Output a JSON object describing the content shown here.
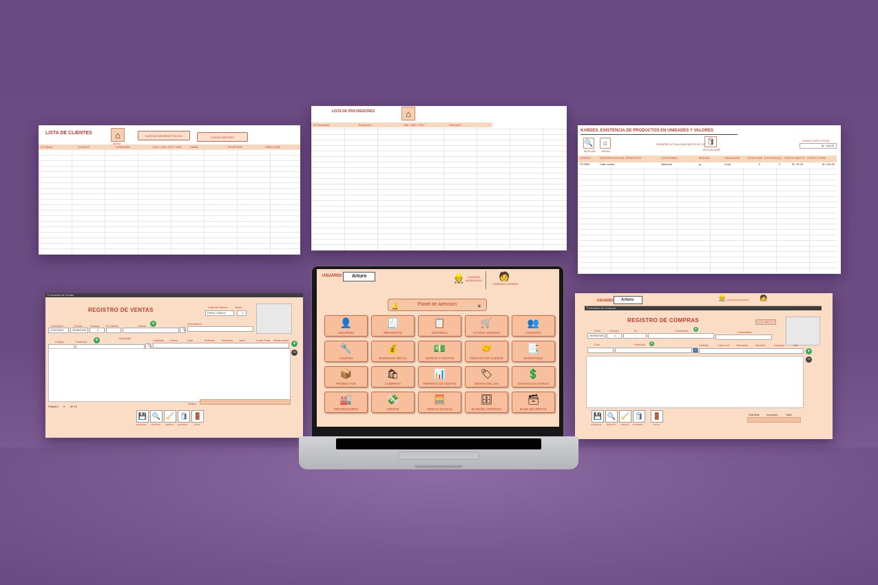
{
  "clientes": {
    "title": "LISTA DE CLIENTES",
    "home_label": "MENU",
    "btn_buscar": "BUSCAR INFORME POR DIA",
    "btn_consultas": "CONSULTAR INFO",
    "headers": [
      "ID Cliente",
      "CLIENTE",
      "COMPAÑÍA",
      "RUC / DNI / RUT / NRC",
      "EMAIL",
      "TELÉFONO",
      "DIRECCIÓN"
    ]
  },
  "proveedores": {
    "title": "LISTA DE PROVEEDORES",
    "headers": [
      "ID Proveedor",
      "Proveedor",
      "DNI / RNC / RUT",
      "Dirección"
    ]
  },
  "kardex": {
    "title": "KARDEX, EXISTENCIA DE PRODUCTOS EN UNIDADES Y VALORES",
    "btn_buscar": "BUSCAR",
    "btn_menu": "MENU",
    "note": "SIEMPRE ACTUALIZAR ANTES DE USAR",
    "btn_actualizar": "ACTUALIZAR",
    "suma_label": "SUMA COSTO TOTAL",
    "suma_value": "$/. 144.00",
    "headers": [
      "CODIGO",
      "DESCRIPCION DEL PRODUCTO",
      "CATEGORIA",
      "MEDIDA",
      "UBICACION",
      "STOCK MINIMO",
      "EXISTENCIA (UNIDADES)",
      "COSTO UNIT PROMEDIO",
      "COSTO TOTAL"
    ],
    "row": [
      "PC2504",
      "Cafe molido",
      "Nacional",
      "pr",
      "Lima",
      "5",
      "2",
      "$/. 20.00",
      "$/. 144.00"
    ]
  },
  "ventas": {
    "bar": "Formulario de Ventas",
    "title": "REGISTRO DE VENTAS",
    "lbl_lista": "Lista de Precios",
    "lbl_stock": "Stock",
    "lbl_condicion": "Condición",
    "lbl_fecha": "Fecha",
    "lbl_factura": "Factura",
    "lbl_cliente": "ID Cliente",
    "lbl_cliente2": "Cliente",
    "lbl_comentario": "Comentario",
    "val_condicion": "CONTADO",
    "val_fecha": "25/06/2025",
    "val_factura": "1",
    "val_lista": "Precio x Menor",
    "val_stock": "1",
    "lbl_codigo": "Codigo",
    "lbl_producto": "Producto",
    "lbl_contenido": "Contenido",
    "cols": [
      "Cantidad",
      "Precio",
      "Subt",
      "Subtotal",
      "Impuesto",
      "Total",
      "Costo Total",
      "Observación"
    ],
    "registro": "Registro",
    "registro_n": "9",
    "registro_de": "de 12",
    "totales": "Totales",
    "buttons": [
      "GUARDAR",
      "BUSCAR",
      "LIMPIAR",
      "ELIMINAR",
      "SALIR"
    ]
  },
  "compras": {
    "usuario_label": "USUARIO:",
    "usuario": "Arturo",
    "ajustar": "AJUSTAR INVENTARIO",
    "cambiar": "CAMBIAR USUARIO",
    "bar": "Formulario de Compras",
    "title": "REGISTRO DE COMPRAS",
    "num": "1",
    "lbl_fecha": "Fech",
    "lbl_factura": "Factura",
    "lbl_id": "ID",
    "lbl_proveedor": "Proveedor",
    "lbl_comentario": "Comentario",
    "val_fecha": "25/06/2025",
    "val_factura": "1",
    "lbl_cod": "Cod.",
    "lbl_producto": "Producto",
    "cols": [
      "Cantidad",
      "Costo Unit",
      "Descuento",
      "SubTotal",
      "Impuesto",
      "Total"
    ],
    "buttons": [
      "GUARDAR",
      "BUSCAR",
      "LIMPIAR",
      "ELIMINAR",
      "SALIR"
    ],
    "foot": [
      "SubTotal",
      "Impuesto",
      "Total"
    ]
  },
  "main": {
    "usuario_label": "USUARIO:",
    "usuario": "Arturo",
    "ajustar": "AJUSTAR INVENTARIO",
    "cambiar": "CAMBIAR USUARIO",
    "panel_title": "Panel de Atencion",
    "buttons": [
      {
        "label": "USUARIOS",
        "icon": "users-icon",
        "glyph": "👤"
      },
      {
        "label": "IMPUESTOS",
        "icon": "tax-icon",
        "glyph": "🧾"
      },
      {
        "label": "HISTORIAL",
        "icon": "history-icon",
        "glyph": "📋"
      },
      {
        "label": "LO MAS VENDIDO",
        "icon": "cart-icon",
        "glyph": "🛒"
      },
      {
        "label": "CLIENTES",
        "icon": "clients-icon",
        "glyph": "👥"
      },
      {
        "label": "AJUSTES",
        "icon": "tools-icon",
        "glyph": "🔧"
      },
      {
        "label": "INVERSION INICIAL",
        "icon": "investment-icon",
        "glyph": "💰"
      },
      {
        "label": "VENTAS Y COSTOS",
        "icon": "sales-costs-icon",
        "glyph": "💵"
      },
      {
        "label": "VENTAS POR CLIENTE",
        "icon": "handshake-icon",
        "glyph": "🤝"
      },
      {
        "label": "INVENTARIO",
        "icon": "inventory-icon",
        "glyph": "📑"
      },
      {
        "label": "PRODUCTOS",
        "icon": "box-icon",
        "glyph": "📦"
      },
      {
        "label": "COMPRAS",
        "icon": "purchase-cart-icon",
        "glyph": "🛍"
      },
      {
        "label": "REPORTE DE VENTAS",
        "icon": "report-icon",
        "glyph": "📊"
      },
      {
        "label": "VENTAS DEL DIA",
        "icon": "day-sales-icon",
        "glyph": "🏷"
      },
      {
        "label": "GANANCIAS DIARIAS",
        "icon": "earnings-icon",
        "glyph": "💲"
      },
      {
        "label": "PROVEEDORES",
        "icon": "supplier-icon",
        "glyph": "🏭"
      },
      {
        "label": "VENTAS",
        "icon": "money-hand-icon",
        "glyph": "💸"
      },
      {
        "label": "VENTAS DIARIAS",
        "icon": "daily-sales-icon",
        "glyph": "🧮"
      },
      {
        "label": "BASE DE COMPRAS",
        "icon": "database-icon",
        "glyph": "🗄"
      },
      {
        "label": "BASE DE VENTAS",
        "icon": "database-sales-icon",
        "glyph": "🗃"
      }
    ]
  }
}
